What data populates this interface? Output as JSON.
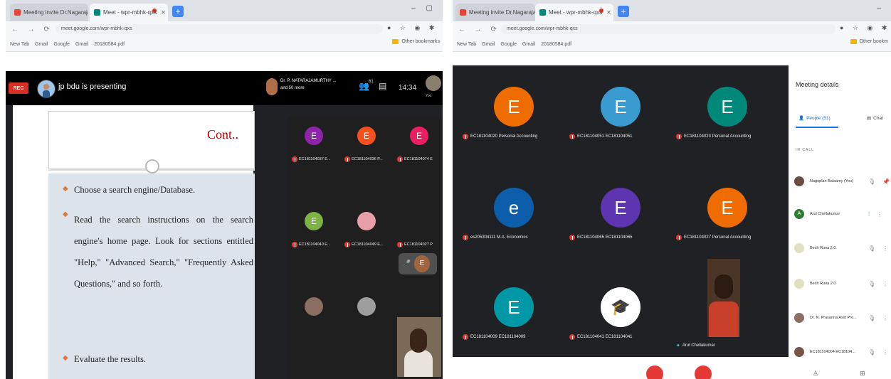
{
  "left": {
    "tabs": [
      {
        "title": "Meeting invite Dr.Nagaraja D.I",
        "state": "inactive"
      },
      {
        "title": "Meet - wpr-mbhk-qxs",
        "state": "active"
      }
    ],
    "url": "meet.google.com/wpr-mbhk-qxs",
    "bookmarks": [
      "New Tab",
      "Gmail",
      "Google",
      "Gmail",
      "20180584.pdf"
    ],
    "other_bookmarks": "Other bookmarks",
    "rec_label": "REC",
    "presenting_text": "jp bdu is presenting",
    "host_name": "Dr. P. NATARAJAMURTHY ...",
    "host_more": "and 50 more",
    "people_count": "61",
    "time": "14:34",
    "you_label": "You",
    "slide": {
      "heading": "Cont..",
      "bullets": [
        "Choose a search engine/Database.",
        "Read the search instructions on the search engine's home page. Look for sections entitled \"Help,\" \"Advanced Search,\" \"Frequently Asked Questions,\" and so forth.",
        "Evaluate the results."
      ]
    },
    "participants": [
      {
        "initial": "E",
        "color": "#8e24aa",
        "name": "EC181104037 E..."
      },
      {
        "initial": "E",
        "color": "#f4511e",
        "name": "EC181104036 P..."
      },
      {
        "initial": "E",
        "color": "#e91e63",
        "name": "EC181104074 E"
      },
      {
        "initial": "E",
        "color": "#7cb342",
        "name": "EC181104040 E..."
      },
      {
        "initial": "",
        "color": "#e8a0a8",
        "name": "EC181104049 E..."
      },
      {
        "initial": "",
        "color": "#a0653f",
        "name": "EC181104027 P"
      },
      {
        "initial": "",
        "color": "#8d6e63",
        "name": ""
      },
      {
        "initial": "",
        "color": "#9e9e9e",
        "name": ""
      }
    ],
    "float_initial": "E"
  },
  "right": {
    "tabs": [
      {
        "title": "Meeting invite Dr.Nagaraja D.I",
        "state": "inactive"
      },
      {
        "title": "Meet - wpr-mbhk-qxs",
        "state": "active"
      }
    ],
    "url": "meet.google.com/wpr-mbhk-qxs",
    "bookmarks": [
      "New Tab",
      "Gmail",
      "Google",
      "Gmail",
      "20180584.pdf"
    ],
    "other_bookmarks": "Other bookm",
    "participants": [
      {
        "initial": "E",
        "color": "#ef6c00",
        "name": "EC181104020 Personal Accounting"
      },
      {
        "initial": "E",
        "color": "#3a9bd1",
        "name": "EC181104051 EC181104051"
      },
      {
        "initial": "E",
        "color": "#00897b",
        "name": "EC181104023 Personal Accounting"
      },
      {
        "initial": "e",
        "color": "#0d5eaa",
        "name": "es205304111 M.A. Economics"
      },
      {
        "initial": "E",
        "color": "#5e35b1",
        "name": "EC181104065 EC181104065"
      },
      {
        "initial": "E",
        "color": "#ef6c00",
        "name": "EC181104027 Personal Accounting"
      },
      {
        "initial": "E",
        "color": "#0097a7",
        "name": "EC181104009 EC181104009"
      },
      {
        "initial": "",
        "color": "#ffffff",
        "name": "EC181104041 EC181104041"
      }
    ],
    "cam_name": "Arul Chellakumar",
    "panel": {
      "title": "Meeting details",
      "people_tab": "People (51)",
      "chat_tab": "Chat",
      "section": "IN CALL",
      "people": [
        {
          "name": "Nagoplan Balaamy (You)",
          "color": "#6d4c41",
          "initial": ""
        },
        {
          "name": "Arul Chellakumar",
          "color": "#2e7d32",
          "initial": "A"
        },
        {
          "name": "Bech Ruoa 2.0",
          "color": "#e0e0c0",
          "initial": ""
        },
        {
          "name": "Bech Ruoa 2.0",
          "color": "#e0e0c0",
          "initial": ""
        },
        {
          "name": "Dr. N. Prasanna Asst Pro...",
          "color": "#8d6e63",
          "initial": ""
        },
        {
          "name": "EC181104004 EC18104...",
          "color": "#795548",
          "initial": ""
        }
      ]
    }
  }
}
